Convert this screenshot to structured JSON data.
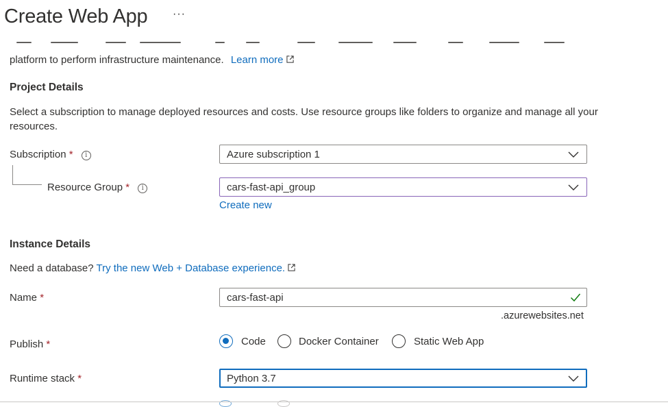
{
  "header": {
    "title": "Create Web App",
    "more": "···"
  },
  "intro": {
    "text": "platform to perform infrastructure maintenance.",
    "learn_more": "Learn more"
  },
  "project": {
    "heading": "Project Details",
    "description": "Select a subscription to manage deployed resources and costs. Use resource groups like folders to organize and manage all your resources.",
    "subscription": {
      "label": "Subscription",
      "required": "*",
      "value": "Azure subscription 1"
    },
    "resource_group": {
      "label": "Resource Group",
      "required": "*",
      "value": "cars-fast-api_group",
      "create_new": "Create new"
    }
  },
  "instance": {
    "heading": "Instance Details",
    "db_prompt": "Need a database?",
    "db_link": "Try the new Web + Database experience.",
    "name": {
      "label": "Name",
      "required": "*",
      "value": "cars-fast-api",
      "suffix": ".azurewebsites.net"
    },
    "publish": {
      "label": "Publish",
      "required": "*",
      "options": [
        "Code",
        "Docker Container",
        "Static Web App"
      ],
      "selected": "Code"
    },
    "runtime": {
      "label": "Runtime stack",
      "required": "*",
      "value": "Python 3.7"
    }
  },
  "icons": {
    "info": "info-icon",
    "external": "external-link-icon",
    "chevron": "chevron-down-icon",
    "check": "checkmark-icon"
  },
  "colors": {
    "link": "#0f6cbd",
    "required": "#a4262c",
    "valid": "#107c10",
    "focus_purple": "#8764b8"
  }
}
